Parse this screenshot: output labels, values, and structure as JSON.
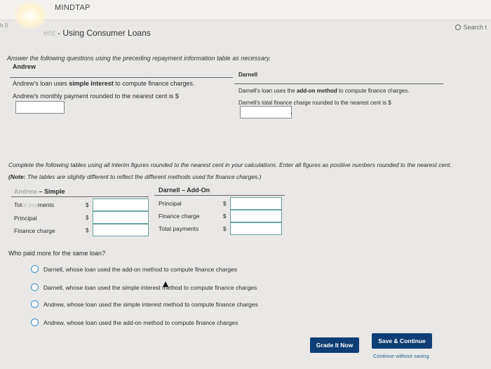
{
  "app": {
    "brand": "MINDTAP",
    "left_fragment": "h 0",
    "search_label": "Search t"
  },
  "page": {
    "title_faded": "ent",
    "title": " - Using Consumer Loans",
    "instructions": "Answer the following questions using the preceding repayment information table as necessary."
  },
  "andrew": {
    "heading": "Andrew",
    "line1_pre": "Andrew's loan uses ",
    "line1_bold": "simple interest",
    "line1_post": " to compute finance charges.",
    "line2": "Andrew's monthly payment rounded to the nearest cent is $",
    "input_value": ""
  },
  "darnell": {
    "heading": "Darnell",
    "line1_pre": "Darnell's loan uses the ",
    "line1_bold": "add-on method",
    "line1_post": " to compute finance charges.",
    "line2": "Darnell's total finance charge rounded to the nearest cent is $",
    "input_value": ""
  },
  "table_instructions": {
    "text": "Complete the following tables using all interim figures rounded to the nearest cent in your calculations. Enter all figures as positive numbers rounded to the nearest cent. ",
    "note_label": "(Note:",
    "note_text": " The tables are slightly different to reflect the different methods used for finance charges.)"
  },
  "tables": {
    "simple": {
      "heading_faded": "Andrew",
      "heading": " – Simple",
      "rows": [
        {
          "label_a": "Tot",
          "label_faded": "al pay",
          "label_b": "ments",
          "currency": "$",
          "value": ""
        },
        {
          "label": "Principal",
          "currency": "$",
          "value": ""
        },
        {
          "label": "Finance charge",
          "currency": "$",
          "value": ""
        }
      ]
    },
    "addon": {
      "heading": "Darnell – Add-On",
      "rows": [
        {
          "label": "Principal",
          "currency": "$",
          "value": ""
        },
        {
          "label": "Finance charge",
          "currency": "$",
          "value": ""
        },
        {
          "label": "Total payments",
          "currency": "$",
          "value": ""
        }
      ]
    }
  },
  "question": {
    "prompt": "Who paid more for the same loan?",
    "options": [
      "Darnell, whose loan used the add-on method to compute finance charges",
      "Darnell, whose loan used the simple interest method to compute finance charges",
      "Andrew, whose loan used the simple interest method to compute finance charges",
      "Andrew, whose loan used the add-on method to compute finance charges"
    ]
  },
  "actions": {
    "grade": "Grade It Now",
    "save": "Save & Continue",
    "continue_link": "Continue without saving"
  }
}
